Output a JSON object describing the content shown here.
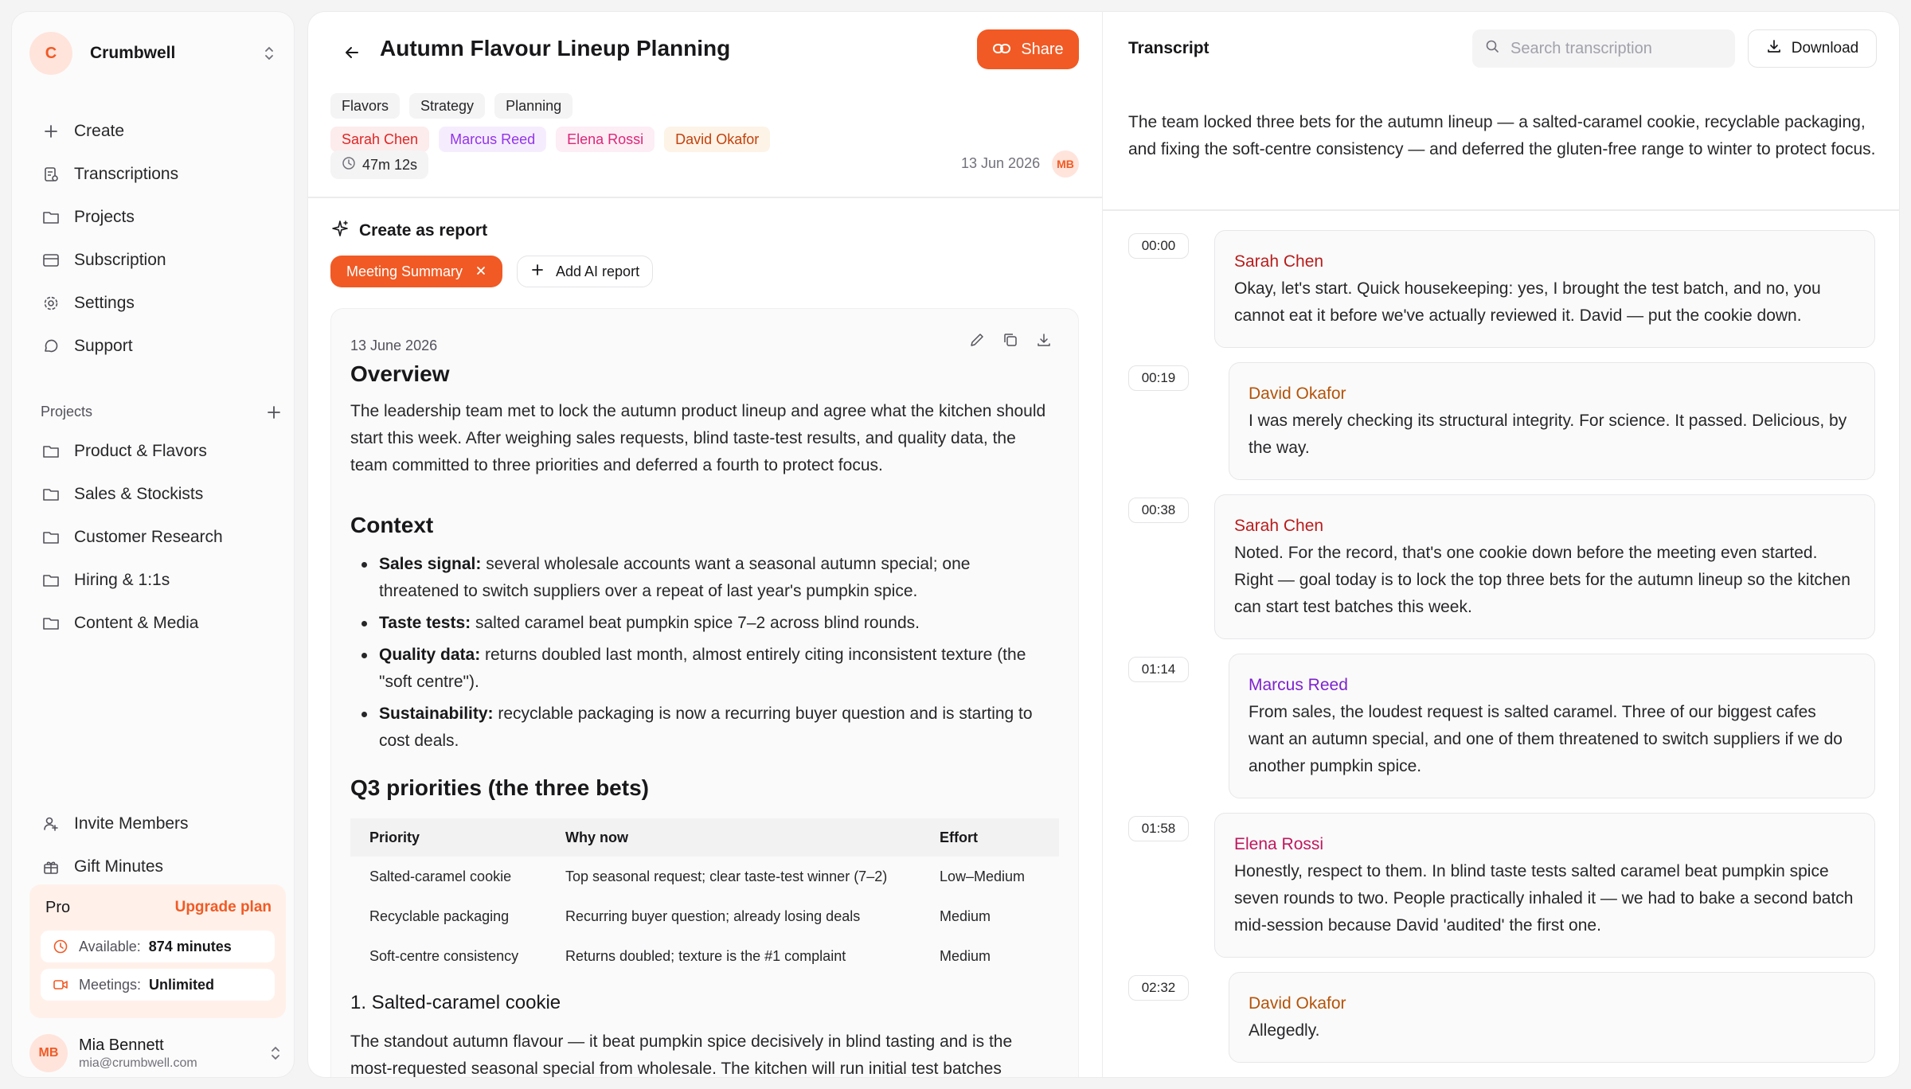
{
  "sidebar": {
    "workspace": {
      "initial": "C",
      "name": "Crumbwell"
    },
    "nav": [
      {
        "label": "Create",
        "icon": "plus-icon"
      },
      {
        "label": "Transcriptions",
        "icon": "transcript-icon"
      },
      {
        "label": "Projects",
        "icon": "folder-icon"
      },
      {
        "label": "Subscription",
        "icon": "card-icon"
      },
      {
        "label": "Settings",
        "icon": "gear-icon"
      },
      {
        "label": "Support",
        "icon": "chat-icon"
      }
    ],
    "projects_label": "Projects",
    "projects": [
      {
        "label": "Product & Flavors"
      },
      {
        "label": "Sales & Stockists"
      },
      {
        "label": "Customer Research"
      },
      {
        "label": "Hiring & 1:1s"
      },
      {
        "label": "Content & Media"
      }
    ],
    "bottom": [
      {
        "label": "Invite Members",
        "icon": "user-plus-icon"
      },
      {
        "label": "Gift Minutes",
        "icon": "gift-icon"
      }
    ],
    "plan": {
      "name": "Pro",
      "upgrade": "Upgrade plan",
      "available_label": "Available:",
      "available_value": "874 minutes",
      "meetings_label": "Meetings:",
      "meetings_value": "Unlimited"
    },
    "user": {
      "initials": "MB",
      "name": "Mia Bennett",
      "email": "mia@crumbwell.com"
    }
  },
  "meeting": {
    "title": "Autumn Flavour Lineup Planning",
    "share": "Share",
    "tags": [
      "Flavors",
      "Strategy",
      "Planning"
    ],
    "speakers": [
      {
        "name": "Sarah Chen",
        "color": "#dc2626",
        "bg": "#fdecec"
      },
      {
        "name": "Marcus Reed",
        "color": "#9333ea",
        "bg": "#f5edfd"
      },
      {
        "name": "Elena Rossi",
        "color": "#db2777",
        "bg": "#fdedf5"
      },
      {
        "name": "David Okafor",
        "color": "#c2410c",
        "bg": "#fdf3e7"
      }
    ],
    "duration": "47m 12s",
    "date": "13 Jun 2026",
    "owner_initials": "MB",
    "create_report": "Create as report",
    "active_report": "Meeting Summary",
    "add_ai_report": "Add AI report"
  },
  "report": {
    "date": "13 June 2026",
    "overview_heading": "Overview",
    "overview": "The leadership team met to lock the autumn product lineup and agree what the kitchen should start this week. After weighing sales requests, blind taste-test results, and quality data, the team committed to three priorities and deferred a fourth to protect focus.",
    "context_heading": "Context",
    "context": [
      {
        "label": "Sales signal:",
        "text": " several wholesale accounts want a seasonal autumn special; one threatened to switch suppliers over a repeat of last year's pumpkin spice."
      },
      {
        "label": "Taste tests:",
        "text": " salted caramel beat pumpkin spice 7–2 across blind rounds."
      },
      {
        "label": "Quality data:",
        "text": " returns doubled last month, almost entirely citing inconsistent texture (the \"soft centre\")."
      },
      {
        "label": "Sustainability:",
        "text": " recyclable packaging is now a recurring buyer question and is starting to cost deals."
      }
    ],
    "priorities_heading": "Q3 priorities (the three bets)",
    "table": {
      "headers": [
        "Priority",
        "Why now",
        "Effort"
      ],
      "rows": [
        [
          "Salted-caramel cookie",
          "Top seasonal request; clear taste-test winner (7–2)",
          "Low–Medium"
        ],
        [
          "Recyclable packaging",
          "Recurring buyer question; already losing deals",
          "Medium"
        ],
        [
          "Soft-centre consistency",
          "Returns doubled; texture is the #1 complaint",
          "Medium"
        ]
      ]
    },
    "section1_heading": "1. Salted-caramel cookie",
    "section1": "The standout autumn flavour — it beat pumpkin spice decisively in blind tasting and is the most-requested seasonal special from wholesale. The kitchen will run initial test batches"
  },
  "transcript": {
    "title": "Transcript",
    "search_placeholder": "Search transcription",
    "download": "Download",
    "summary": "The team locked three bets for the autumn lineup — a salted-caramel cookie, recyclable packaging, and fixing the soft-centre consistency — and deferred the gluten-free range to winter to protect focus.",
    "entries": [
      {
        "time": "00:00",
        "speaker": "Sarah Chen",
        "color": "#b91c1c",
        "text": "Okay, let's start. Quick housekeeping: yes, I brought the test batch, and no, you cannot eat it before we've actually reviewed it. David — put the cookie down."
      },
      {
        "time": "00:19",
        "speaker": "David Okafor",
        "color": "#b45309",
        "text": "I was merely checking its structural integrity. For science. It passed. Delicious, by the way."
      },
      {
        "time": "00:38",
        "speaker": "Sarah Chen",
        "color": "#b91c1c",
        "text": "Noted. For the record, that's one cookie down before the meeting even started. Right — goal today is to lock the top three bets for the autumn lineup so the kitchen can start test batches this week."
      },
      {
        "time": "01:14",
        "speaker": "Marcus Reed",
        "color": "#7e22ce",
        "text": "From sales, the loudest request is salted caramel. Three of our biggest cafes want an autumn special, and one of them threatened to switch suppliers if we do another pumpkin spice."
      },
      {
        "time": "01:58",
        "speaker": "Elena Rossi",
        "color": "#be185d",
        "text": "Honestly, respect to them. In blind taste tests salted caramel beat pumpkin spice seven rounds to two. People practically inhaled it — we had to bake a second batch mid-session because David 'audited' the first one."
      },
      {
        "time": "02:32",
        "speaker": "David Okafor",
        "color": "#b45309",
        "text": "Allegedly."
      }
    ]
  },
  "colors": {
    "accent": "#f15a24",
    "accent_soft": "#fff1ea"
  }
}
